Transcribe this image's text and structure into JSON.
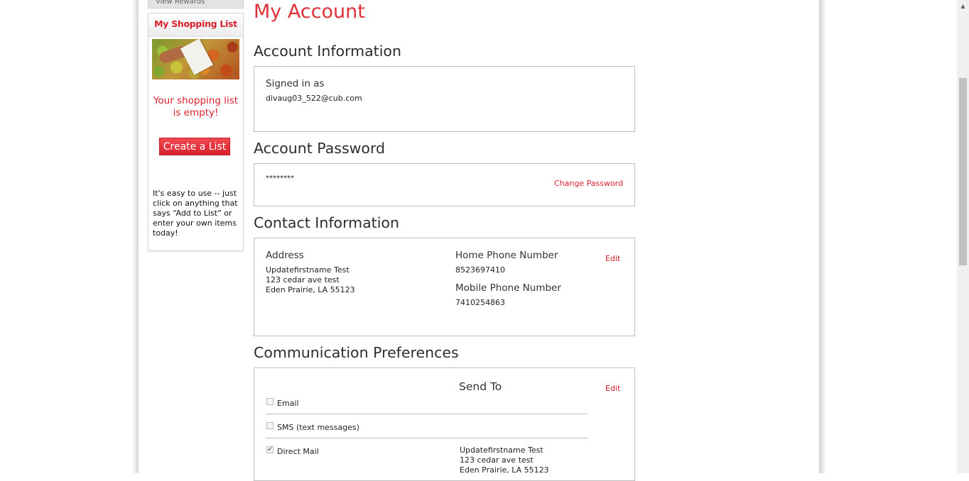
{
  "sidebar": {
    "rewards_tab_label": "View Rewards",
    "shopping_list": {
      "title": "My Shopping List",
      "empty_message": "Your shopping list is empty!",
      "create_button": "Create a List",
      "help_text": "It's easy to use -- just click on anything that says “Add to List” or enter your own items today!"
    }
  },
  "main": {
    "page_title": "My Account",
    "account_information": {
      "title": "Account Information",
      "signed_in_label": "Signed in as",
      "email": "divaug03_522@cub.com"
    },
    "account_password": {
      "title": "Account Password",
      "masked_password": "********",
      "change_link": "Change Password"
    },
    "contact_information": {
      "title": "Contact Information",
      "address_label": "Address",
      "address_lines": [
        "Updatefirstname Test",
        "123 cedar ave test",
        "Eden Prairie, LA 55123"
      ],
      "home_phone_label": "Home Phone Number",
      "home_phone": "8523697410",
      "mobile_phone_label": "Mobile Phone Number",
      "mobile_phone": "7410254863",
      "edit_link": "Edit"
    },
    "communication_preferences": {
      "title": "Communication Preferences",
      "send_to_label": "Send To",
      "edit_link": "Edit",
      "options": [
        {
          "label": "Email",
          "checked": false
        },
        {
          "label": "SMS (text messages)",
          "checked": false
        },
        {
          "label": "Direct Mail",
          "checked": true
        }
      ],
      "mail_address_lines": [
        "Updatefirstname Test",
        "123 cedar ave test",
        "Eden Prairie, LA 55123"
      ]
    }
  },
  "colors": {
    "brand_red": "#e0313a",
    "link_red": "#d9212e",
    "border_gray": "#bdbdbd"
  }
}
